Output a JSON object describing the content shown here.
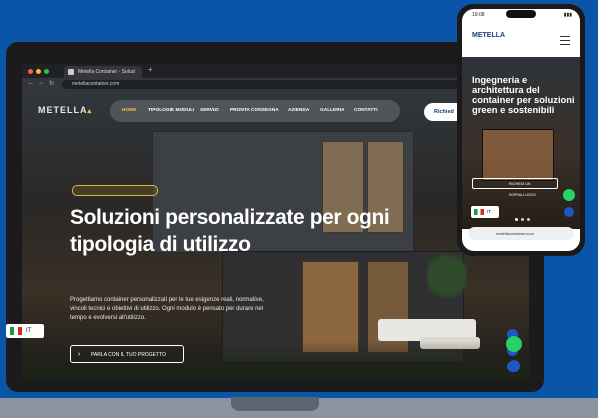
{
  "browser": {
    "tab_title": "Metella Container - Soluzi",
    "address": "metellacontainer.com"
  },
  "site": {
    "logo": "METELLA",
    "nav": [
      "HOME",
      "TIPOLOGIE MODULI",
      "SERVIZI",
      "PRONTA CONSEGNA",
      "AZIENDA",
      "GALLERIA",
      "CONTATTI"
    ],
    "cta_header": "Richied",
    "headline": "Soluzioni personalizzate per ogni tipologia di utilizzo",
    "subtext": "Progettiamo container personalizzati per le tue esigenze reali, normative, vincoli tecnici e obiettivi di utilizzo. Ogni modulo è pensato per durare nel tempo e evolversi all'utilizzo.",
    "cta": "PARLA CON IL TUO PROGETTO",
    "lang": "IT"
  },
  "phone": {
    "time": "19:08",
    "logo": "METELLA",
    "title": "Ingegneria e architettura del container per soluzioni green e sostenibili",
    "cta": "RICHIEDI UN SOPRALLUOGO",
    "lang": "IT",
    "url": "metellacontainer.com"
  },
  "colors": {
    "background": "#0b55a8",
    "accent": "#f3c24b",
    "whatsapp": "#25d366"
  }
}
